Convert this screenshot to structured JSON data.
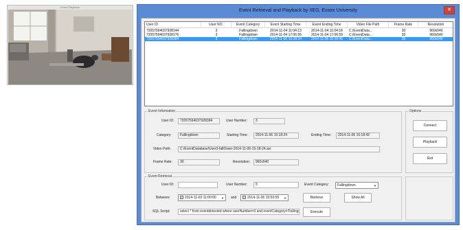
{
  "preview": {
    "title": "Event Playback"
  },
  "dialog": {
    "title": "Event Retrieval and Playback       by IIEG, Essex University",
    "close_glyph": "✕"
  },
  "table": {
    "columns": [
      "User ID",
      "User NO.",
      "Event Category",
      "Event Starting Time",
      "Event Ending Time",
      "Video File Path",
      "Frame Rate",
      "Resolution"
    ],
    "rows": [
      [
        "72057594037928144",
        "3",
        "Fallingdown",
        "2014-11-04 11:04:13",
        "2014-11-04 11:04:18",
        "C:/EventData...",
        "30",
        "960x540"
      ],
      [
        "72057594037928176",
        "3",
        "Fallingdown",
        "2014-11-04 17:06:55",
        "2014-11-04 17:06:59",
        "C:/EventData...",
        "30",
        "960x540"
      ],
      [
        "72057594037928384",
        "3",
        "Fallingdown",
        "2014-11-06 15:18:24",
        "2014-11-06 15:18:42",
        "C:/EventData...",
        "30",
        "960x540"
      ]
    ],
    "selected_row": 2
  },
  "event_info": {
    "title": "Event Information",
    "user_id_label": "User ID:",
    "user_id": "72057594037928384",
    "user_number_label": "User Number:",
    "user_number": "3",
    "category_label": "Category:",
    "category": "Fallingdown",
    "starting_label": "Starting Time:",
    "starting_time": "2014-11-06 15:18:24",
    "ending_label": "Ending Time:",
    "ending_time": "2014-11-06 15:18:42",
    "video_path_label": "Video Path:",
    "video_path": "C:/EventDatabase/User3-fallDown-2014-11-06-15-18-24.avi",
    "frame_rate_label": "Frame Rate:",
    "frame_rate": "30",
    "resolution_label": "Resolution:",
    "resolution": "960x540"
  },
  "options": {
    "title": "Options",
    "connect": "Connect",
    "playback": "Playback",
    "exit": "Exit"
  },
  "retrieval": {
    "title": "Event Retrieval",
    "user_id_label": "User ID:",
    "user_id": "",
    "user_number_label": "User Number:",
    "user_number": "3",
    "category_label": "Event Category:",
    "category": "Fallingdown",
    "between_label": "Between:",
    "from": "2014-11-03  11:00:00",
    "and_label": "and",
    "to": "2014-11-06  15:59:59",
    "checkbox_mark": "✓",
    "retrieve": "Retrieve",
    "show_all": "Show All",
    "sql_label": "SQL Script:",
    "sql": "select * from eventdetected where   userNumber=3 and eventCategory='Fallingdown' a",
    "execute": "Execute"
  },
  "colors": {
    "title_bar": "#5b8bd4",
    "close_button": "#c7473f",
    "selection": "#3399ff",
    "client_bg": "#f0f0f0"
  }
}
